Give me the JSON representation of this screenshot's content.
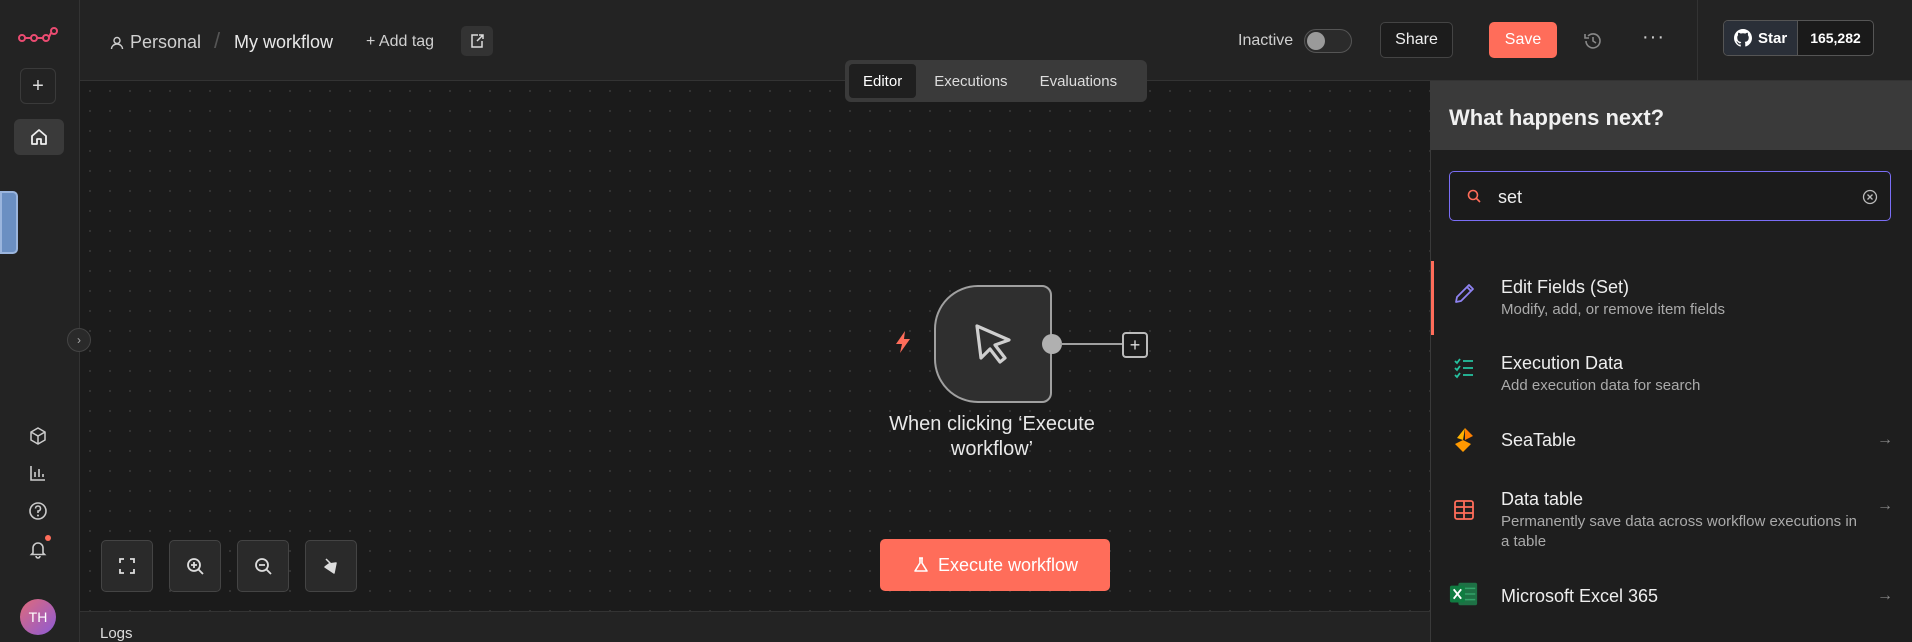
{
  "header": {
    "project": "Personal",
    "workflow_title": "My workflow",
    "add_tag": "+ Add tag",
    "status_label": "Inactive",
    "share_label": "Share",
    "save_label": "Save",
    "github_star_label": "Star",
    "github_star_count": "165,282"
  },
  "view_tabs": [
    {
      "label": "Editor",
      "active": true
    },
    {
      "label": "Executions",
      "active": false
    },
    {
      "label": "Evaluations",
      "active": false
    }
  ],
  "rail": {
    "avatar_initials": "TH"
  },
  "canvas": {
    "trigger_node_label": "When clicking ‘Execute workflow’",
    "execute_button": "Execute workflow"
  },
  "logs": {
    "label": "Logs"
  },
  "panel": {
    "title": "What happens next?",
    "search_value": "set",
    "items": [
      {
        "title": "Edit Fields (Set)",
        "desc": "Modify, add, or remove item fields",
        "icon": "pencil-icon"
      },
      {
        "title": "Execution Data",
        "desc": "Add execution data for search",
        "icon": "checklist-icon"
      },
      {
        "title": "SeaTable",
        "desc": "",
        "icon": "seatable-icon"
      },
      {
        "title": "Data table",
        "desc": "Permanently save data across workflow executions in a table",
        "icon": "table-icon"
      },
      {
        "title": "Microsoft Excel 365",
        "desc": "",
        "icon": "excel-icon"
      }
    ]
  },
  "colors": {
    "accent": "#ff6d5a",
    "focus": "#7b6ef6"
  }
}
